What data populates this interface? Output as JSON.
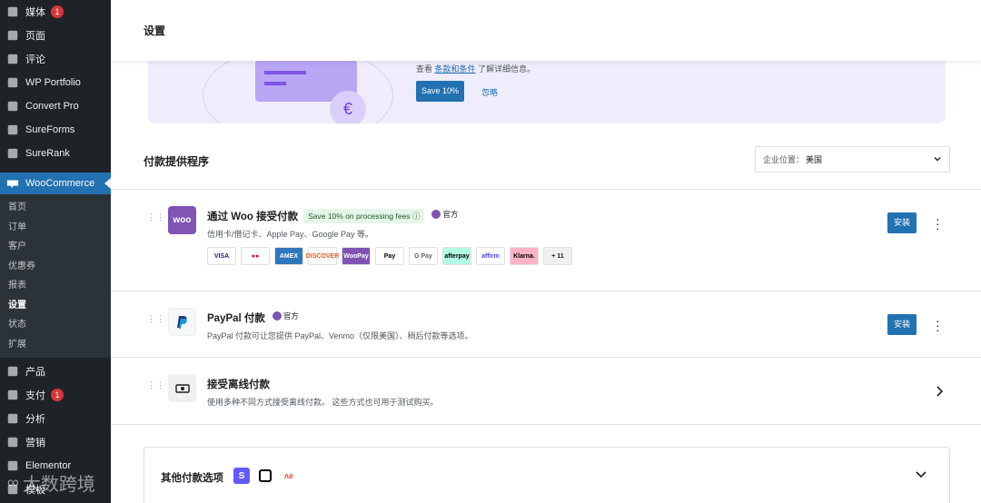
{
  "sidebar": {
    "items_top": [
      {
        "label": "媒体",
        "icon": "media-icon",
        "badge": "1"
      },
      {
        "label": "页面",
        "icon": "page-icon",
        "badge": ""
      },
      {
        "label": "评论",
        "icon": "comment-icon",
        "badge": ""
      },
      {
        "label": "WP Portfolio",
        "icon": "portfolio-icon",
        "badge": ""
      },
      {
        "label": "Convert Pro",
        "icon": "convert-pro-icon",
        "badge": ""
      },
      {
        "label": "SureForms",
        "icon": "sureforms-icon",
        "badge": ""
      },
      {
        "label": "SureRank",
        "icon": "surerank-icon",
        "badge": ""
      }
    ],
    "woocommerce": "WooCommerce",
    "submenu": [
      "首页",
      "订单",
      "客户",
      "优惠券",
      "报表",
      "设置",
      "状态",
      "扩展"
    ],
    "items_bottom": [
      {
        "label": "产品",
        "icon": "product-icon",
        "badge": ""
      },
      {
        "label": "支付",
        "icon": "payments-icon",
        "badge": "1"
      },
      {
        "label": "分析",
        "icon": "analytics-icon",
        "badge": ""
      },
      {
        "label": "营销",
        "icon": "marketing-icon",
        "badge": ""
      },
      {
        "label": "Elementor",
        "icon": "elementor-icon",
        "badge": ""
      },
      {
        "label": "模板",
        "icon": "templates-icon",
        "badge": ""
      }
    ]
  },
  "header": {
    "title": "设置"
  },
  "promo": {
    "note_prefix": "查看",
    "note_link": "条款和条件",
    "note_suffix": "了解详细信息。",
    "save_label": "Save 10%",
    "ignore_label": "忽略"
  },
  "providers": {
    "title": "付款提供程序",
    "location_label": "企业位置：",
    "location_value": "美国",
    "woo": {
      "logo": "woo",
      "name": "通过 Woo 接受付款",
      "pill": "Save 10% on processing fees",
      "official": "官方",
      "desc": "信用卡/借记卡、Apple Pay、Google Pay 等。",
      "install": "安装",
      "methods": [
        {
          "label": "VISA",
          "color": "#1a1f71",
          "bg": "#ffffff"
        },
        {
          "label": "●●",
          "color": "#eb001b",
          "bg": "#ffffff"
        },
        {
          "label": "AMEX",
          "color": "#ffffff",
          "bg": "#2e77bc"
        },
        {
          "label": "DISCOVER",
          "color": "#e55c20",
          "bg": "#ffffff"
        },
        {
          "label": "WooPay",
          "color": "#ffffff",
          "bg": "#7f54b3"
        },
        {
          "label": " Pay",
          "color": "#000000",
          "bg": "#ffffff"
        },
        {
          "label": "G Pay",
          "color": "#5f6368",
          "bg": "#ffffff"
        },
        {
          "label": "afterpay",
          "color": "#000000",
          "bg": "#b2fce4"
        },
        {
          "label": "affirm",
          "color": "#4a4af4",
          "bg": "#ffffff"
        },
        {
          "label": "Klarna.",
          "color": "#000000",
          "bg": "#ffb3c7"
        },
        {
          "label": "+ 11",
          "color": "#1e1e1e",
          "bg": "#f0f0f0"
        }
      ]
    },
    "paypal": {
      "name": "PayPal 付款",
      "official": "官方",
      "desc": "PayPal 付款可让您提供 PayPal、Venmo（仅限美国）、稍后付款等选项。",
      "install": "安装"
    },
    "offline": {
      "name": "接受离线付款",
      "desc": "使用多种不同方式接受离线付款。 这些方式也可用于测试购买。"
    },
    "other": {
      "title": "其他付款选项"
    }
  },
  "watermark": "大数跨境"
}
